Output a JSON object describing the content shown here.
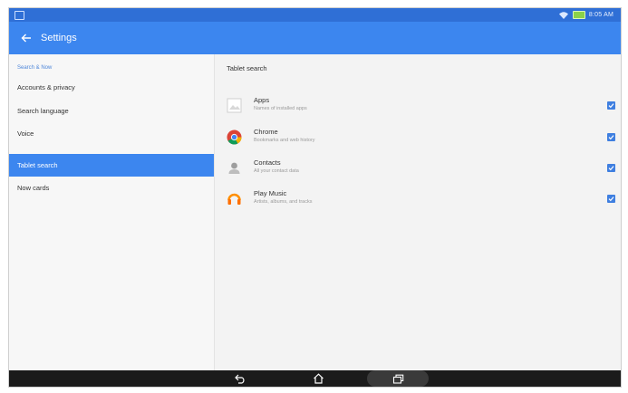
{
  "status_bar": {
    "time": "8:05 AM"
  },
  "app_bar": {
    "title": "Settings"
  },
  "sidebar": {
    "header": "Search & Now",
    "items": [
      {
        "label": "Accounts & privacy"
      },
      {
        "label": "Search language"
      },
      {
        "label": "Voice"
      },
      {
        "label": "Tablet search",
        "selected": true
      },
      {
        "label": "Now cards"
      }
    ]
  },
  "main": {
    "title": "Tablet search",
    "rows": [
      {
        "title": "Apps",
        "subtitle": "Names of installed apps",
        "icon": "apps-icon",
        "checked": true
      },
      {
        "title": "Chrome",
        "subtitle": "Bookmarks and web history",
        "icon": "chrome-icon",
        "checked": true
      },
      {
        "title": "Contacts",
        "subtitle": "All your contact data",
        "icon": "contacts-icon",
        "checked": true
      },
      {
        "title": "Play Music",
        "subtitle": "Artists, albums, and tracks",
        "icon": "play-music-icon",
        "checked": true
      }
    ]
  },
  "navigation_bar": {
    "buttons": [
      "back-icon",
      "home-icon",
      "recents-icon"
    ]
  },
  "colors": {
    "status_bar": "#2f6fd6",
    "app_bar": "#3c86ef",
    "selected_item": "#3c86ef",
    "checkbox": "#3f7fe0",
    "nav_bar": "#1b1b1b"
  }
}
